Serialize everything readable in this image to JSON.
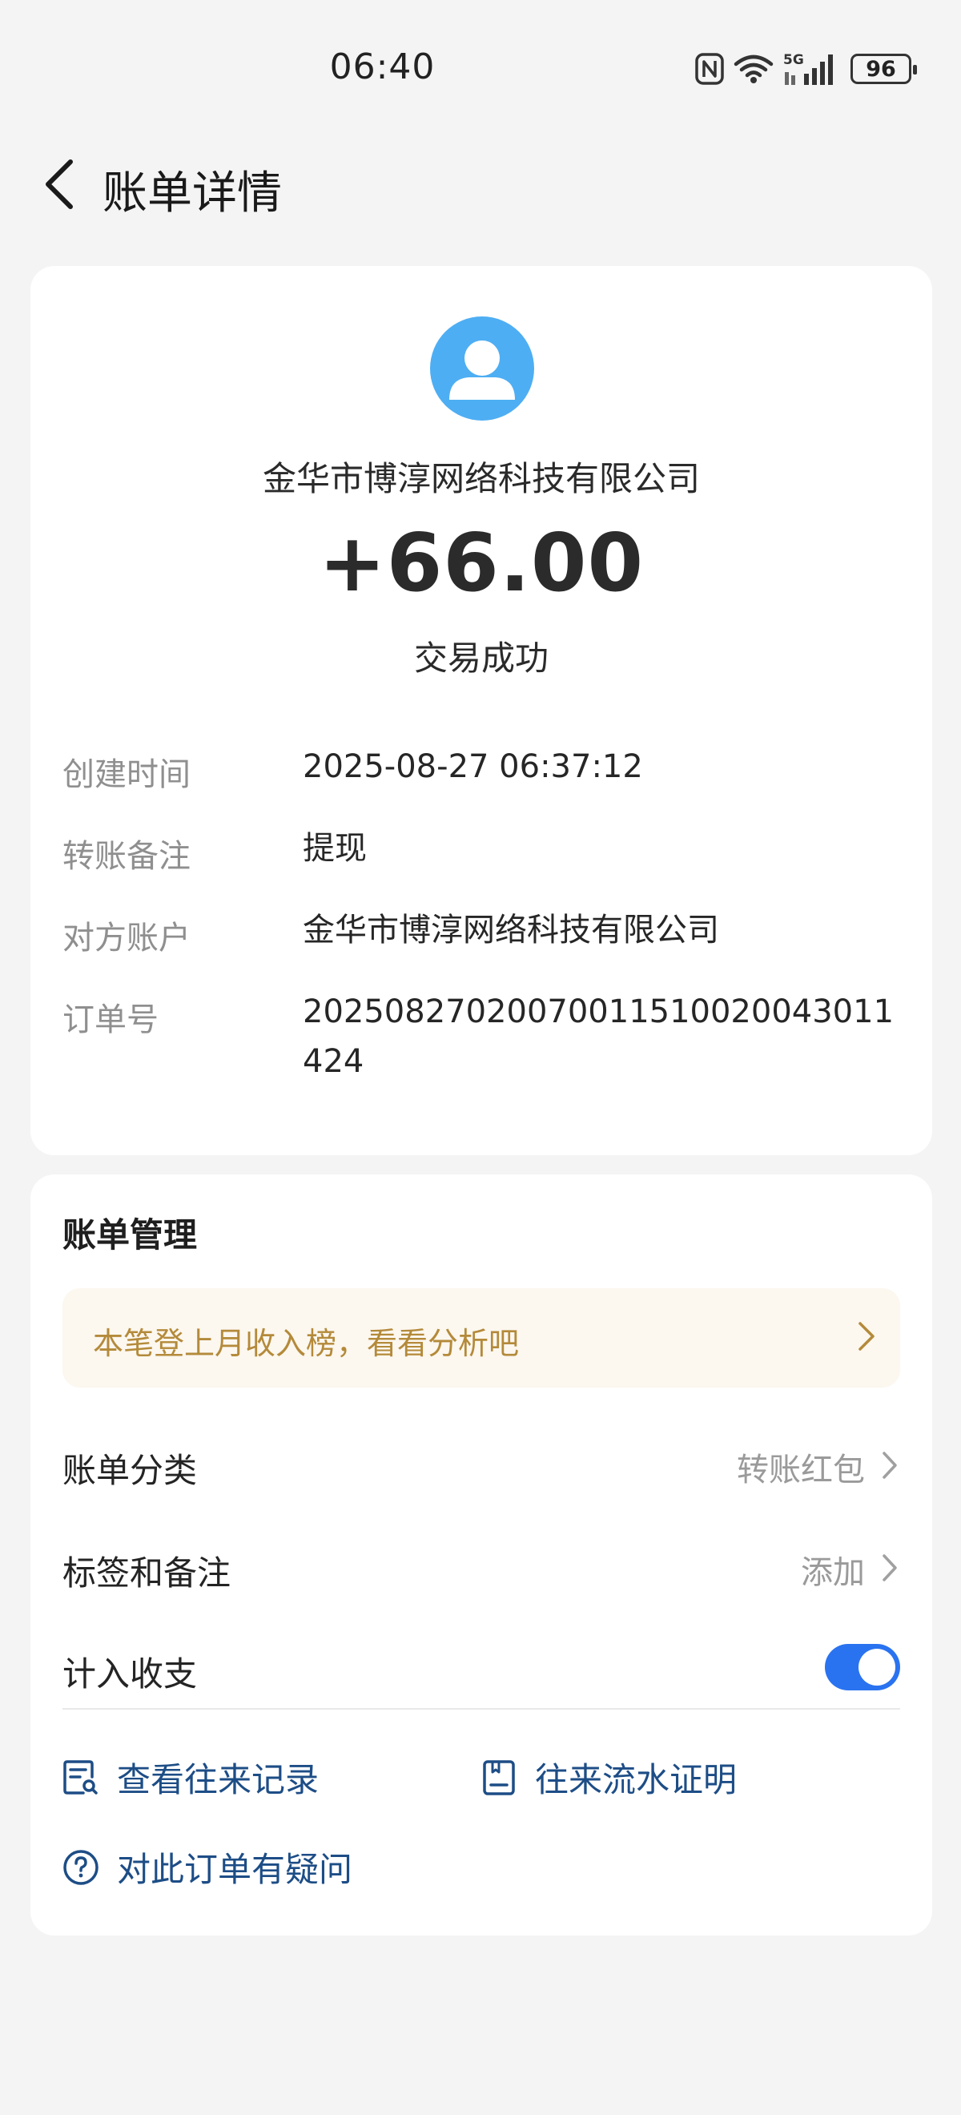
{
  "status_bar": {
    "time": "06:40",
    "icons": [
      "nfc-icon",
      "wifi-icon",
      "5g-signal-icon",
      "battery-icon"
    ],
    "network": "5G",
    "battery": "96"
  },
  "header": {
    "back_icon": "chevron-left-icon",
    "title": "账单详情"
  },
  "transaction": {
    "avatar_icon": "user-avatar-icon",
    "counterparty": "金华市博淳网络科技有限公司",
    "amount": "+66.00",
    "status": "交易成功",
    "details": [
      {
        "label": "创建时间",
        "value": "2025-08-27 06:37:12"
      },
      {
        "label": "转账备注",
        "value": "提现"
      },
      {
        "label": "对方账户",
        "value": "金华市博淳网络科技有限公司"
      },
      {
        "label": "订单号",
        "value": "20250827020070011510020043011424"
      }
    ]
  },
  "management": {
    "title": "账单管理",
    "banner": {
      "text": "本笔登上月收入榜，看看分析吧",
      "icon": "chevron-right-icon"
    },
    "category": {
      "label": "账单分类",
      "value": "转账红包"
    },
    "tags": {
      "label": "标签和备注",
      "value": "添加"
    },
    "income": {
      "label": "计入收支",
      "enabled": true
    },
    "links": {
      "records": {
        "label": "查看往来记录",
        "icon": "records-search-icon"
      },
      "proof": {
        "label": "往来流水证明",
        "icon": "document-icon"
      },
      "question": {
        "label": "对此订单有疑问",
        "icon": "question-circle-icon"
      }
    }
  },
  "colors": {
    "background": "#f4f4f5",
    "avatar": "#4eaef3",
    "banner_bg": "#fcf7ef",
    "banner_text": "#b48a3a",
    "toggle_on": "#2a73f0",
    "link": "#1d4d86"
  }
}
